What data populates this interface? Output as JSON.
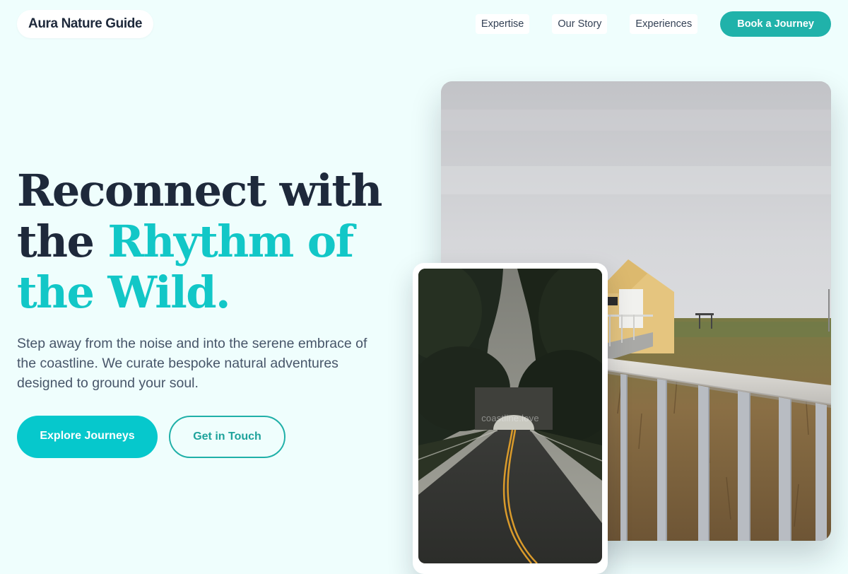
{
  "brand": {
    "name": "Aura Nature Guide"
  },
  "nav": {
    "links": [
      "Expertise",
      "Our Story",
      "Experiences"
    ],
    "cta": "Book a Journey"
  },
  "hero": {
    "title_line1": "Reconnect with",
    "title_line2_plain": "the ",
    "title_line2_accent": "Rhythm of",
    "title_line3_accent": "the Wild.",
    "subtitle": "Step away from the noise and into the serene embrace of the coastline. We curate bespoke natural adventures designed to ground your soul.",
    "primary_button": "Explore Journeys",
    "secondary_button": "Get in Touch"
  },
  "images": {
    "main_alt": "Yellow beach hut and boardwalk behind a metal railing in coastal grassland",
    "inset_alt": "Tree-lined road leading to a stone bridge tunnel",
    "inset_watermark": "coastline.love"
  },
  "colors": {
    "background": "#effefd",
    "accent": "#12c7c7",
    "primary_button": "#06c8cc",
    "nav_cta": "#20b2aa",
    "heading": "#1e293b",
    "body_text": "#475569"
  }
}
